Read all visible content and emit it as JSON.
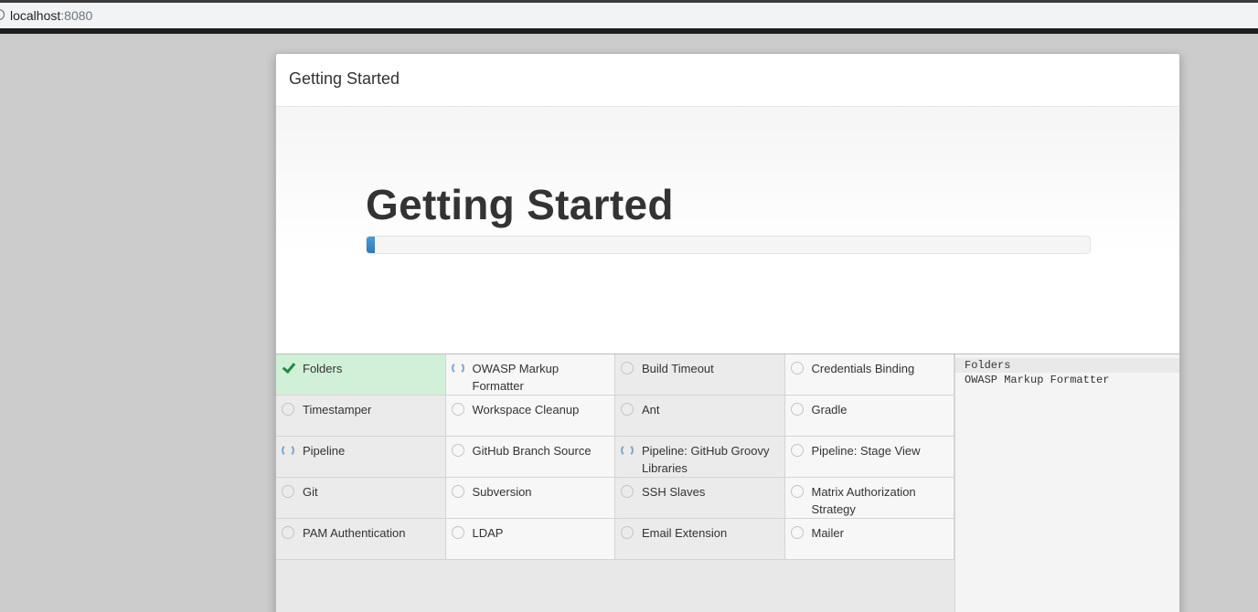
{
  "browser": {
    "host": "localhost",
    "port": ":8080"
  },
  "modal": {
    "title": "Getting Started"
  },
  "hero": {
    "heading": "Getting Started",
    "progress_fraction": 0.012
  },
  "plugins": [
    {
      "label": "Folders",
      "status": "installed"
    },
    {
      "label": "OWASP Markup Formatter",
      "status": "installing"
    },
    {
      "label": "Build Timeout",
      "status": "pending"
    },
    {
      "label": "Credentials Binding",
      "status": "pending"
    },
    {
      "label": "Timestamper",
      "status": "pending"
    },
    {
      "label": "Workspace Cleanup",
      "status": "pending"
    },
    {
      "label": "Ant",
      "status": "pending"
    },
    {
      "label": "Gradle",
      "status": "pending"
    },
    {
      "label": "Pipeline",
      "status": "installing"
    },
    {
      "label": "GitHub Branch Source",
      "status": "pending"
    },
    {
      "label": "Pipeline: GitHub Groovy Libraries",
      "status": "installing"
    },
    {
      "label": "Pipeline: Stage View",
      "status": "pending"
    },
    {
      "label": "Git",
      "status": "pending"
    },
    {
      "label": "Subversion",
      "status": "pending"
    },
    {
      "label": "SSH Slaves",
      "status": "pending"
    },
    {
      "label": "Matrix Authorization Strategy",
      "status": "pending"
    },
    {
      "label": "PAM Authentication",
      "status": "pending"
    },
    {
      "label": "LDAP",
      "status": "pending"
    },
    {
      "label": "Email Extension",
      "status": "pending"
    },
    {
      "label": "Mailer",
      "status": "pending"
    }
  ],
  "log": [
    "Folders",
    "OWASP Markup Formatter"
  ]
}
